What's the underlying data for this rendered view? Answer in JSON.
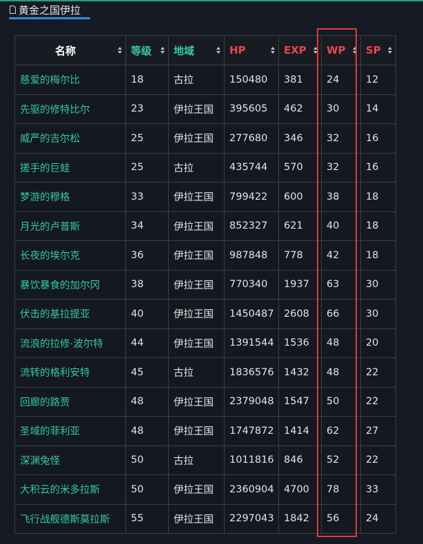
{
  "section": {
    "title": "黄金之国伊拉"
  },
  "table": {
    "headers": [
      "名称",
      "等级",
      "地域",
      "HP",
      "EXP",
      "WP",
      "SP"
    ],
    "rows": [
      [
        "慈爱的梅尔比",
        "18",
        "古拉",
        "150480",
        "381",
        "24",
        "12"
      ],
      [
        "先驱的修特比尔",
        "23",
        "伊拉王国",
        "395605",
        "462",
        "30",
        "14"
      ],
      [
        "威严的吉尔松",
        "25",
        "伊拉王国",
        "277680",
        "346",
        "32",
        "16"
      ],
      [
        "搓手的巨蛙",
        "25",
        "古拉",
        "435744",
        "570",
        "32",
        "16"
      ],
      [
        "梦游的穆格",
        "33",
        "伊拉王国",
        "799422",
        "600",
        "38",
        "18"
      ],
      [
        "月光的卢普斯",
        "34",
        "伊拉王国",
        "852327",
        "621",
        "40",
        "18"
      ],
      [
        "长夜的埃尔克",
        "36",
        "伊拉王国",
        "987848",
        "778",
        "42",
        "18"
      ],
      [
        "暴饮暴食的加尔冈",
        "38",
        "伊拉王国",
        "770340",
        "1937",
        "63",
        "30"
      ],
      [
        "伏击的基拉提亚",
        "40",
        "伊拉王国",
        "1450487",
        "2608",
        "66",
        "30"
      ],
      [
        "流浪的拉修·波尔特",
        "44",
        "伊拉王国",
        "1391544",
        "1536",
        "48",
        "20"
      ],
      [
        "流转的格利安特",
        "45",
        "古拉",
        "1836576",
        "1432",
        "48",
        "22"
      ],
      [
        "回廊的路贾",
        "48",
        "伊拉王国",
        "2379048",
        "1547",
        "50",
        "22"
      ],
      [
        "圣域的菲利亚",
        "48",
        "伊拉王国",
        "1747872",
        "1414",
        "62",
        "27"
      ],
      [
        "深渊兔怪",
        "50",
        "古拉",
        "1011816",
        "846",
        "52",
        "22"
      ],
      [
        "大积云的米多拉斯",
        "50",
        "伊拉王国",
        "2360904",
        "4700",
        "78",
        "33"
      ],
      [
        "飞行战舰德斯莫拉斯",
        "55",
        "伊拉王国",
        "2297043",
        "1842",
        "56",
        "24"
      ]
    ]
  },
  "icons": {
    "tab": "document-icon",
    "sort": "sort-arrows-icon"
  },
  "colors": {
    "background": "#161a24",
    "name_text": "#36c9a0",
    "header_red": "#e8454f",
    "highlight": "#e03c3c",
    "tab_underline": "#2f8fd8"
  }
}
